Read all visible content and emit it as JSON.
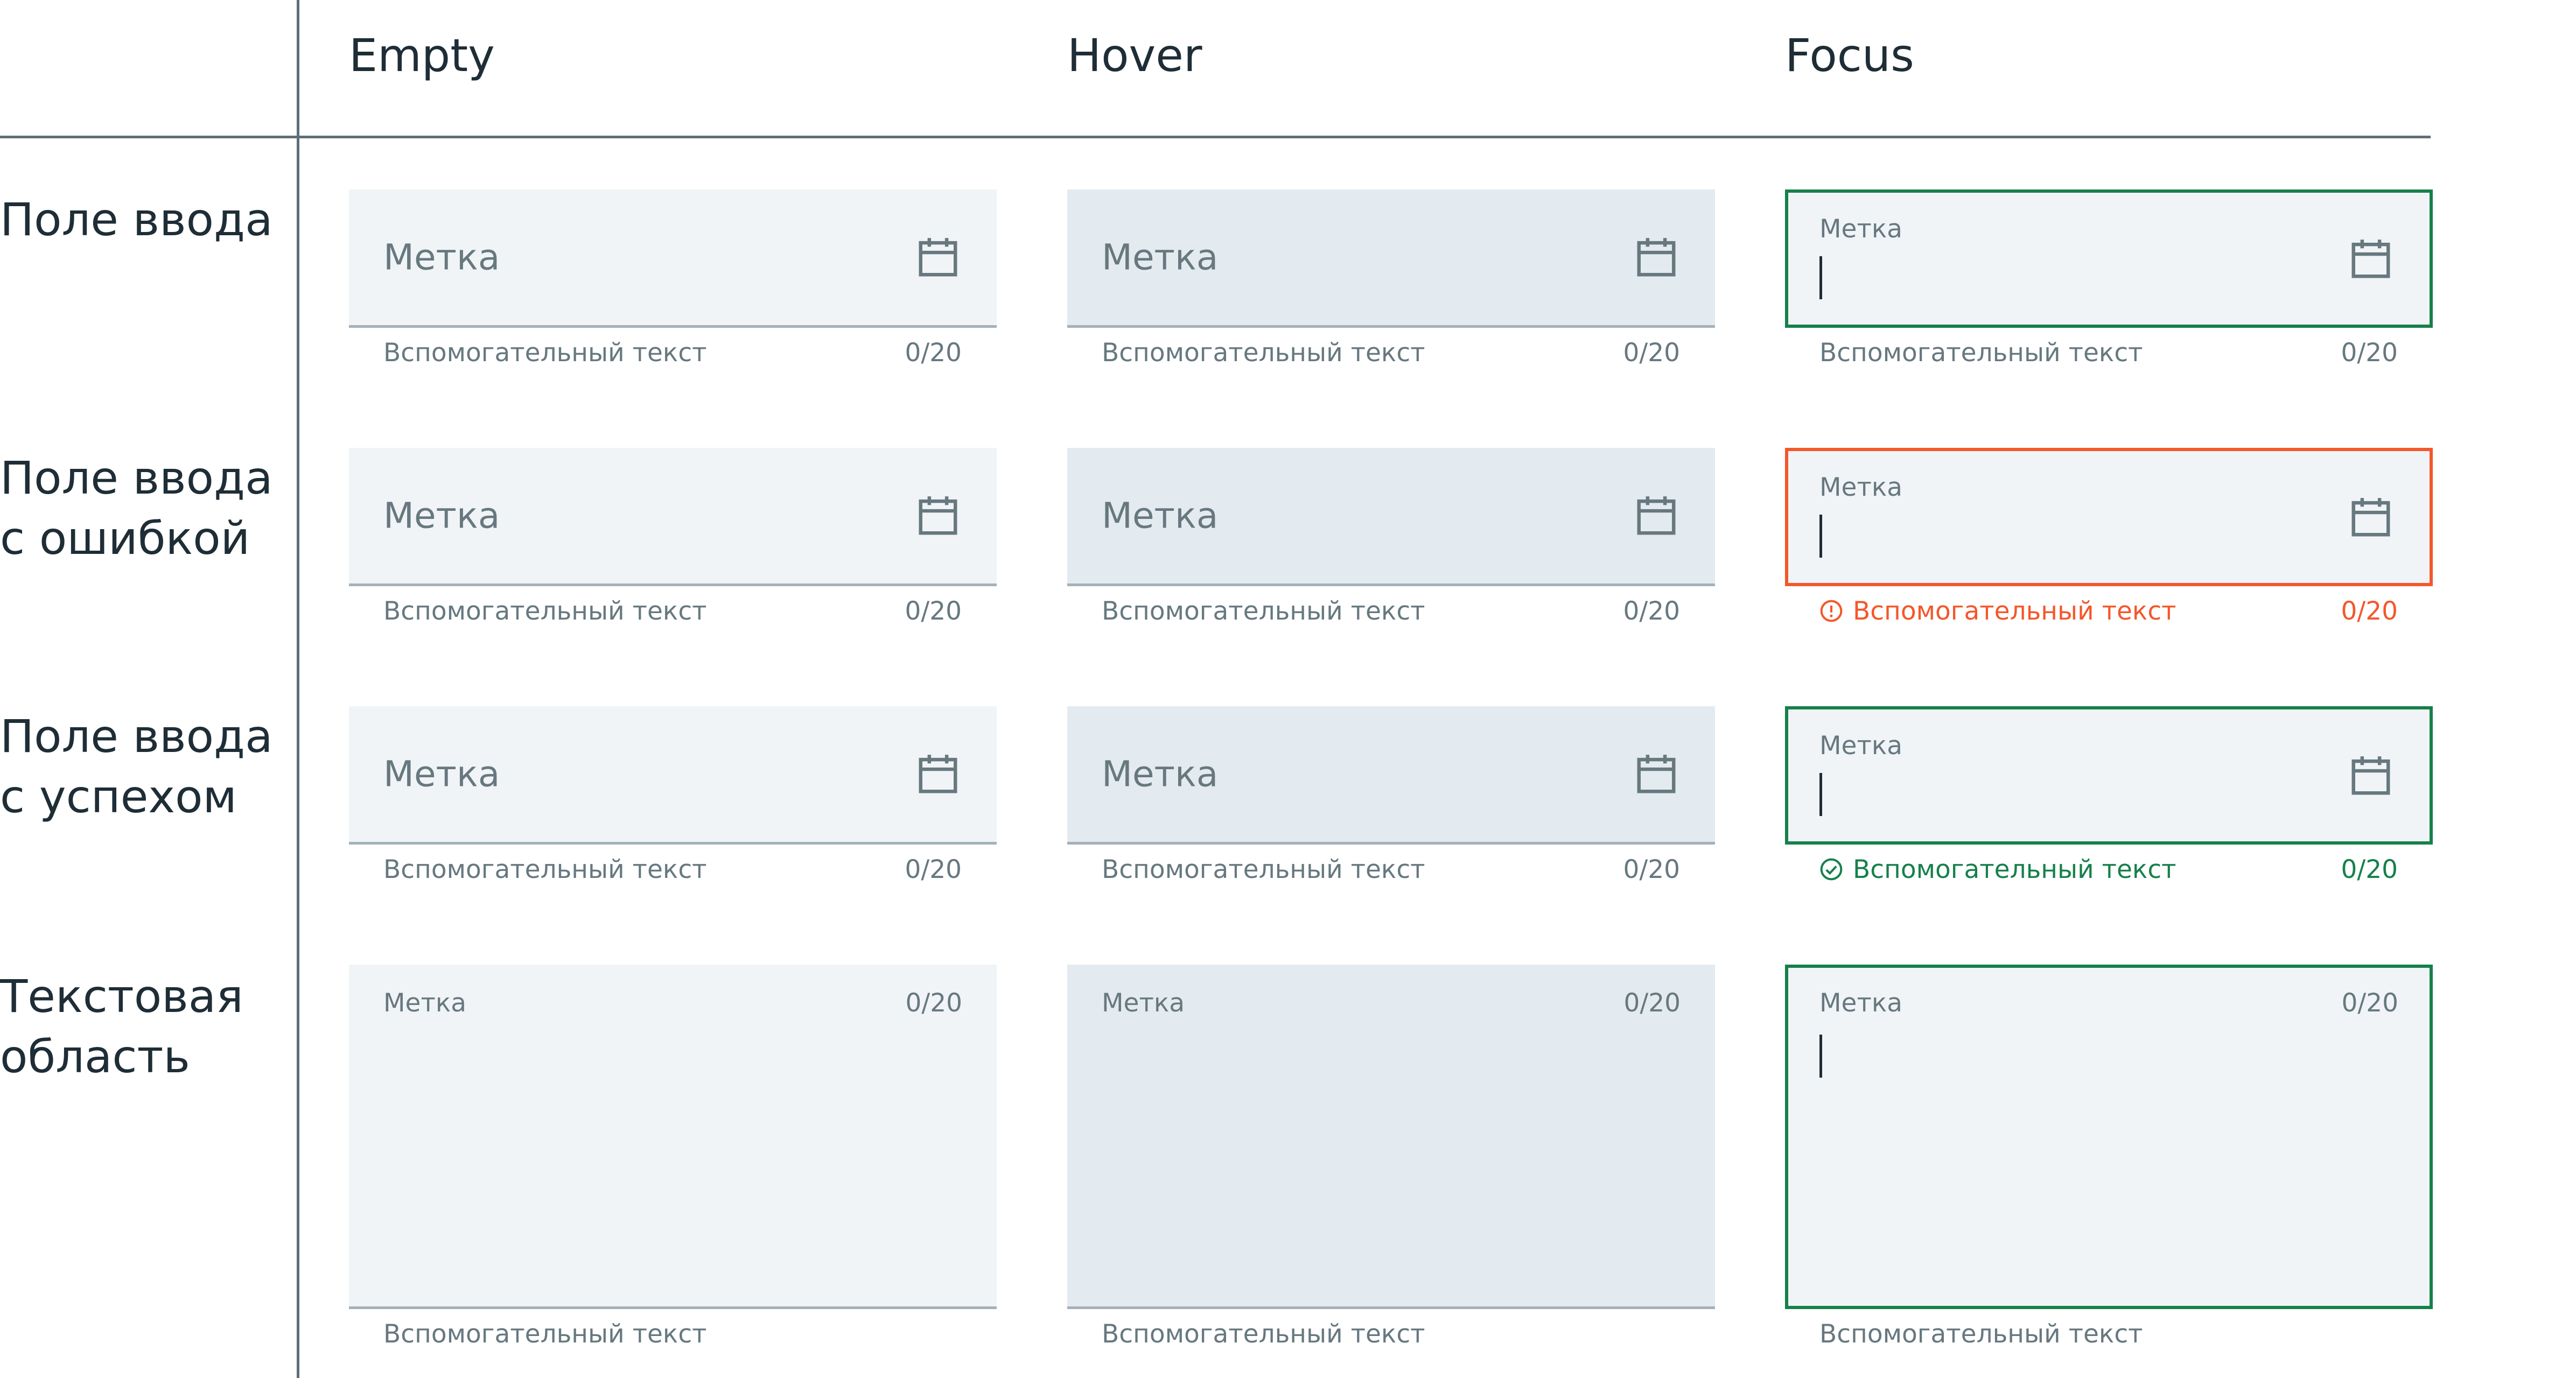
{
  "columns": [
    "Empty",
    "Hover",
    "Focus"
  ],
  "rows": {
    "input": [
      "Поле ввода"
    ],
    "error": [
      "Поле ввода",
      "с ошибкой"
    ],
    "success": [
      "Поле ввода",
      "с успехом"
    ],
    "textarea": [
      "Текстовая",
      "область"
    ]
  },
  "field": {
    "label": "Метка",
    "helper": "Вспомогательный текст",
    "counter": "0/20",
    "trailing_icon": "calendar-icon"
  },
  "status": {
    "error_icon": "alert-circle-icon",
    "success_icon": "check-circle-icon"
  },
  "colors": {
    "empty_bg": "#f0f4f7",
    "hover_bg": "#e3eaf0",
    "focus_border": "#16804b",
    "error": "#f4572a",
    "success": "#16804b",
    "underline": "#a5b1b8",
    "muted_text": "#67787f",
    "text": "#1e2d36"
  }
}
